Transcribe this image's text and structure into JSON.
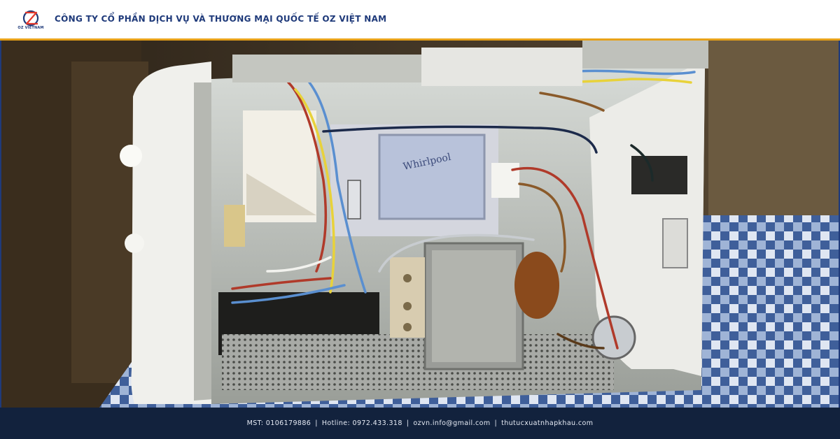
{
  "header": {
    "logo_caption": "OZ VIETNAM",
    "company_name": "CÔNG TY CỔ PHẦN DỊCH VỤ VÀ THƯƠNG MẠI QUỐC TẾ OZ VIỆT NAM"
  },
  "photo": {
    "label": "image-open-microwave-oven-interior",
    "brand_text": "Whirlpool"
  },
  "footer": {
    "mst": "MST: 0106179886",
    "hotline": "Hotline: 0972.433.318",
    "email": "ozvn.info@gmail.com",
    "website": "thutucxuatnhapkhau.com",
    "separator": "|"
  },
  "colors": {
    "brand_navy": "#1f3a7a",
    "accent_orange": "#e8a21a",
    "footer_bg": "#12223d"
  }
}
